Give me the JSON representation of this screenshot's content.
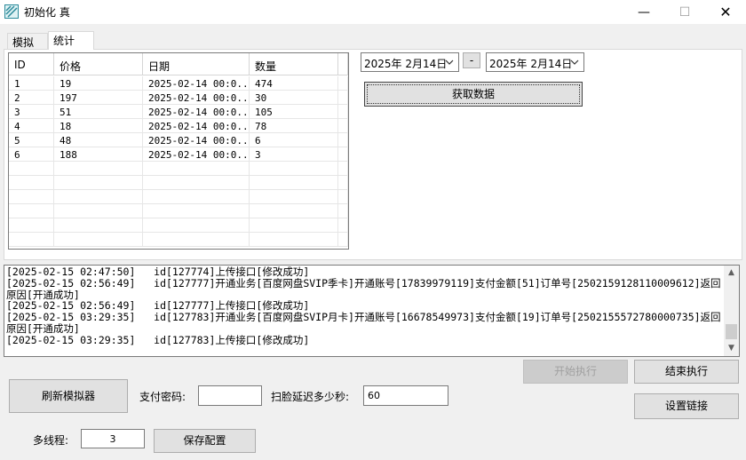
{
  "window": {
    "title": "初始化 真",
    "min_glyph": "—",
    "max_glyph": "☐",
    "close_glyph": "✕"
  },
  "tabs": [
    {
      "label": "模拟"
    },
    {
      "label": "统计"
    }
  ],
  "grid": {
    "columns": [
      "ID",
      "价格",
      "日期",
      "数量"
    ],
    "rows": [
      [
        "1",
        "19",
        "2025-02-14 00:0...",
        "474"
      ],
      [
        "2",
        "197",
        "2025-02-14 00:0...",
        "30"
      ],
      [
        "3",
        "51",
        "2025-02-14 00:0...",
        "105"
      ],
      [
        "4",
        "18",
        "2025-02-14 00:0...",
        "78"
      ],
      [
        "5",
        "48",
        "2025-02-14 00:0...",
        "6"
      ],
      [
        "6",
        "188",
        "2025-02-14 00:0...",
        "3"
      ]
    ]
  },
  "date_range": {
    "start": "2025年 2月14日",
    "separator": "-",
    "end": "2025年 2月14日"
  },
  "fetch_button": "获取数据",
  "log_text": "[2025-02-15 02:47:50]   id[127774]上传接口[修改成功]\n[2025-02-15 02:56:49]   id[127777]开通业务[百度网盘SVIP季卡]开通账号[17839979119]支付金额[51]订单号[2502159128110009612]返回原因[开通成功]\n[2025-02-15 02:56:49]   id[127777]上传接口[修改成功]\n[2025-02-15 03:29:35]   id[127783]开通业务[百度网盘SVIP月卡]开通账号[16678549973]支付金额[19]订单号[2502155572780000735]返回原因[开通成功]\n[2025-02-15 03:29:35]   id[127783]上传接口[修改成功]",
  "buttons": {
    "start": "开始执行",
    "stop": "结束执行",
    "refresh": "刷新模拟器",
    "link": "设置链接",
    "save": "保存配置"
  },
  "form": {
    "pay_password_label": "支付密码:",
    "pay_password_value": "",
    "scan_delay_label": "扫脸延迟多少秒:",
    "scan_delay_value": "60",
    "threads_label": "多线程:",
    "threads_value": "3"
  },
  "colors": {
    "disabled_text": "#a0a0a0",
    "button_face": "#e1e1e1",
    "border": "#adadad"
  }
}
